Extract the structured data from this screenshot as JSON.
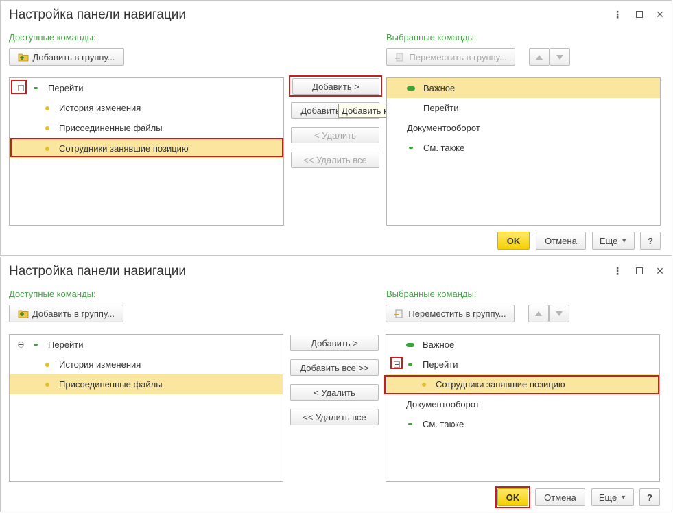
{
  "dialog1": {
    "title": "Настройка панели навигации",
    "available_label": "Доступные команды:",
    "selected_label": "Выбранные команды:",
    "add_to_group": "Добавить в группу...",
    "move_to_group": "Переместить в группу...",
    "available_items": [
      "Перейти",
      "История изменения",
      "Присоединенные файлы",
      "Сотрудники занявшие позицию"
    ],
    "selected_items": [
      "Важное",
      "Перейти",
      "Документооборот",
      "См. также"
    ],
    "add": "Добавить >",
    "add_all": "Добавить все >>",
    "remove": "< Удалить",
    "remove_all": "<< Удалить все",
    "tooltip": "Добавить команду",
    "ok": "OK",
    "cancel": "Отмена",
    "more": "Еще",
    "help": "?"
  },
  "dialog2": {
    "title": "Настройка панели навигации",
    "available_label": "Доступные команды:",
    "selected_label": "Выбранные команды:",
    "add_to_group": "Добавить в группу...",
    "move_to_group": "Переместить в группу...",
    "available_items": [
      "Перейти",
      "История изменения",
      "Присоединенные файлы"
    ],
    "selected_items": [
      "Важное",
      "Перейти",
      "Сотрудники занявшие позицию",
      "Документооборот",
      "См. также"
    ],
    "add": "Добавить >",
    "add_all": "Добавить все >>",
    "remove": "< Удалить",
    "remove_all": "<< Удалить все",
    "ok": "OK",
    "cancel": "Отмена",
    "more": "Еще",
    "help": "?"
  },
  "colors": {
    "accent_green": "#4aa04a",
    "selection": "#fbe6a0",
    "highlight_red": "#cc1b1b",
    "ok_yellow": "#f5cf00"
  }
}
